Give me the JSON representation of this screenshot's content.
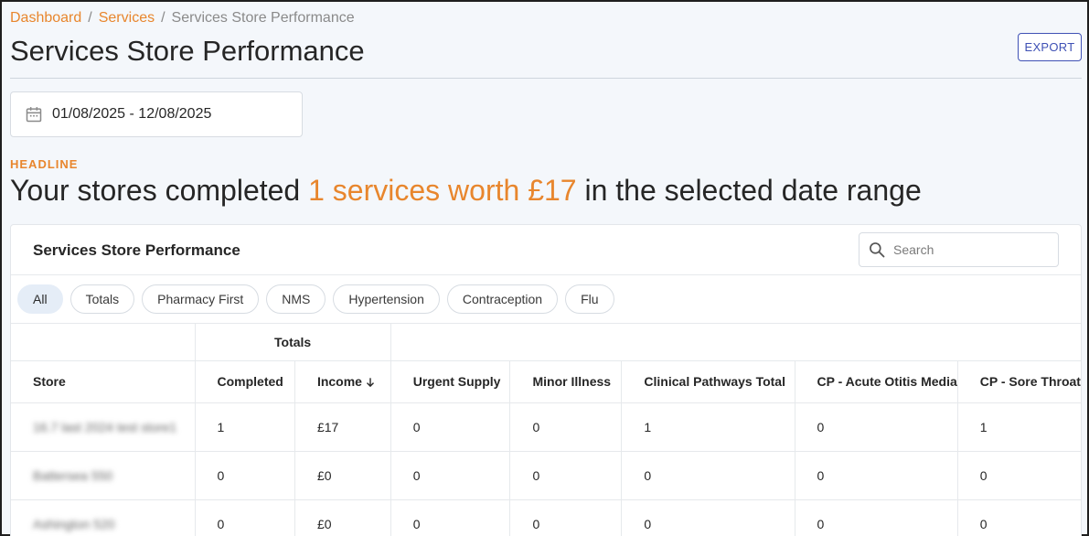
{
  "breadcrumb": {
    "items": [
      "Dashboard",
      "Services"
    ],
    "current": "Services Store Performance",
    "separator": "/"
  },
  "page_title": "Services Store Performance",
  "export_label": "EXPORT",
  "date_range": {
    "value": "01/08/2025 - 12/08/2025",
    "icon": "calendar-icon"
  },
  "headline": {
    "label": "HEADLINE",
    "prefix": "Your stores completed ",
    "highlight": "1 services worth £17",
    "suffix": " in the selected date range"
  },
  "card": {
    "title": "Services Store Performance",
    "search_placeholder": "Search",
    "chips": [
      "All",
      "Totals",
      "Pharmacy First",
      "NMS",
      "Hypertension",
      "Contraception",
      "Flu"
    ],
    "active_chip": "All"
  },
  "table": {
    "group_header": "Totals",
    "columns": [
      "Store",
      "Completed",
      "Income",
      "Urgent Supply",
      "Minor Illness",
      "Clinical Pathways Total",
      "CP - Acute Otitis Media",
      "CP - Sore Throat"
    ],
    "sorted_column": "Income",
    "sort_direction": "descending",
    "rows": [
      [
        "16.7 last 2024 test store1",
        "1",
        "£17",
        "0",
        "0",
        "1",
        "0",
        "1"
      ],
      [
        "Battersea 550",
        "0",
        "£0",
        "0",
        "0",
        "0",
        "0",
        "0"
      ],
      [
        "Ashington 520",
        "0",
        "£0",
        "0",
        "0",
        "0",
        "0",
        "0"
      ]
    ]
  },
  "colors": {
    "accent": "#e8862d",
    "primary": "#3f51b5",
    "background": "#f4f7fb"
  }
}
